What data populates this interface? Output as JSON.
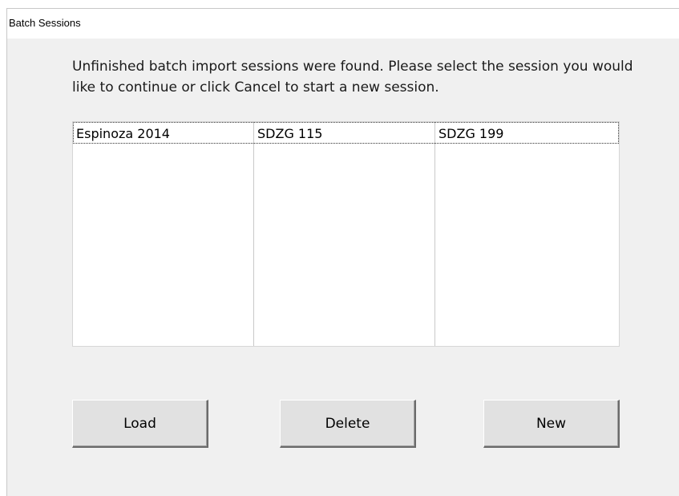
{
  "window": {
    "title": "Batch Sessions"
  },
  "message": "Unfinished batch import sessions were found. Please select the session you would like to continue or click Cancel to start a new session.",
  "sessions": {
    "rows": [
      [
        "Espinoza 2014",
        "SDZG 115",
        "SDZG 199"
      ]
    ]
  },
  "buttons": {
    "load": "Load",
    "delete": "Delete",
    "new": "New"
  }
}
